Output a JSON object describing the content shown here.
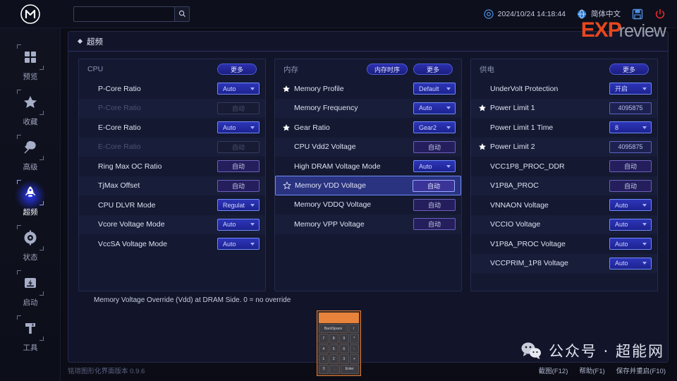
{
  "topbar": {
    "logo_name": "maxsun-logo",
    "search_value": "",
    "search_placeholder": "",
    "search_icon": "search-icon",
    "datetime": "2024/10/24 14:18:44",
    "datetime_icon": "clock-icon",
    "language": "简体中文",
    "language_icon": "globe-icon",
    "save_icon": "save-icon",
    "power_icon": "power-icon"
  },
  "watermark": {
    "exp": "EXP",
    "review": "review",
    "wechat_icon": "wechat-icon",
    "wechat_text": "公众号 · 超能网"
  },
  "sidebar": {
    "items": [
      {
        "label": "预览",
        "icon": "grid-icon",
        "active": false
      },
      {
        "label": "收藏",
        "icon": "star-icon",
        "active": false
      },
      {
        "label": "高级",
        "icon": "wrench-icon",
        "active": false
      },
      {
        "label": "超频",
        "icon": "rocket-icon",
        "active": true
      },
      {
        "label": "状态",
        "icon": "gauge-icon",
        "active": false
      },
      {
        "label": "启动",
        "icon": "boot-icon",
        "active": false
      },
      {
        "label": "工具",
        "icon": "tools-icon",
        "active": false
      }
    ]
  },
  "tab": {
    "label": "超频",
    "bullet_icon": "diamond-bullet-icon"
  },
  "columns": [
    {
      "title": "CPU",
      "buttons": [
        {
          "label": "更多",
          "name": "cpu-more-button"
        }
      ],
      "rows": [
        {
          "label": "P-Core Ratio",
          "value": "Auto",
          "type": "select",
          "star": false,
          "disabled": false,
          "selected": false
        },
        {
          "label": "P-Core Ratio",
          "value": "自动",
          "type": "text",
          "star": false,
          "disabled": true,
          "selected": false
        },
        {
          "label": "E-Core Ratio",
          "value": "Auto",
          "type": "select",
          "star": false,
          "disabled": false,
          "selected": false
        },
        {
          "label": "E-Core Ratio",
          "value": "自动",
          "type": "text",
          "star": false,
          "disabled": true,
          "selected": false
        },
        {
          "label": "Ring Max OC Ratio",
          "value": "自动",
          "type": "text",
          "star": false,
          "disabled": false,
          "selected": false
        },
        {
          "label": "TjMax Offset",
          "value": "自动",
          "type": "text",
          "star": false,
          "disabled": false,
          "selected": false
        },
        {
          "label": "CPU DLVR Mode",
          "value": "Regulat",
          "type": "select",
          "star": false,
          "disabled": false,
          "selected": false
        },
        {
          "label": "Vcore Voltage Mode",
          "value": "Auto",
          "type": "select",
          "star": false,
          "disabled": false,
          "selected": false
        },
        {
          "label": "VccSA Voltage Mode",
          "value": "Auto",
          "type": "select",
          "star": false,
          "disabled": false,
          "selected": false
        }
      ]
    },
    {
      "title": "内存",
      "buttons": [
        {
          "label": "内存时序",
          "name": "memory-timing-button"
        },
        {
          "label": "更多",
          "name": "memory-more-button"
        }
      ],
      "rows": [
        {
          "label": "Memory Profile",
          "value": "Default",
          "type": "select",
          "star": true,
          "disabled": false,
          "selected": false
        },
        {
          "label": "Memory Frequency",
          "value": "Auto",
          "type": "select",
          "star": false,
          "disabled": false,
          "selected": false
        },
        {
          "label": "Gear Ratio",
          "value": "Gear2",
          "type": "select",
          "star": true,
          "disabled": false,
          "selected": false
        },
        {
          "label": "CPU Vdd2 Voltage",
          "value": "自动",
          "type": "text",
          "star": false,
          "disabled": false,
          "selected": false
        },
        {
          "label": "High DRAM Voltage Mode",
          "value": "Auto",
          "type": "select",
          "star": false,
          "disabled": false,
          "selected": false
        },
        {
          "label": "Memory VDD Voltage",
          "value": "自动",
          "type": "text",
          "star": "hollow",
          "disabled": false,
          "selected": true
        },
        {
          "label": "Memory VDDQ Voltage",
          "value": "自动",
          "type": "text",
          "star": false,
          "disabled": false,
          "selected": false
        },
        {
          "label": "Memory VPP Voltage",
          "value": "自动",
          "type": "text",
          "star": false,
          "disabled": false,
          "selected": false
        }
      ]
    },
    {
      "title": "供电",
      "buttons": [
        {
          "label": "更多",
          "name": "power-more-button"
        }
      ],
      "rows": [
        {
          "label": "UnderVolt Protection",
          "value": "开启",
          "type": "select",
          "star": false,
          "disabled": false,
          "selected": false
        },
        {
          "label": "Power Limit 1",
          "value": "4095875",
          "type": "num",
          "star": true,
          "disabled": false,
          "selected": false
        },
        {
          "label": "Power Limit 1 Time",
          "value": "8",
          "type": "select",
          "star": false,
          "disabled": false,
          "selected": false
        },
        {
          "label": "Power Limit 2",
          "value": "4095875",
          "type": "num",
          "star": true,
          "disabled": false,
          "selected": false
        },
        {
          "label": "VCC1P8_PROC_DDR",
          "value": "自动",
          "type": "text",
          "star": false,
          "disabled": false,
          "selected": false
        },
        {
          "label": "V1P8A_PROC",
          "value": "自动",
          "type": "text",
          "star": false,
          "disabled": false,
          "selected": false
        },
        {
          "label": "VNNAON Voltage",
          "value": "Auto",
          "type": "select",
          "star": false,
          "disabled": false,
          "selected": false
        },
        {
          "label": "VCCIO Voltage",
          "value": "Auto",
          "type": "select",
          "star": false,
          "disabled": false,
          "selected": false
        },
        {
          "label": "V1P8A_PROC Voltage",
          "value": "Auto",
          "type": "select",
          "star": false,
          "disabled": false,
          "selected": false
        },
        {
          "label": "VCCPRIM_1P8 Voltage",
          "value": "Auto",
          "type": "select",
          "star": false,
          "disabled": false,
          "selected": false
        }
      ]
    }
  ],
  "help": {
    "text": "Memory Voltage Override (Vdd) at DRAM Side. 0 = no override"
  },
  "keypad": {
    "display": "",
    "rows": [
      [
        {
          "label": "BackSpace",
          "wide": 3
        },
        {
          "label": "/",
          "wide": 1
        }
      ],
      [
        {
          "label": "7"
        },
        {
          "label": "8"
        },
        {
          "label": "9"
        },
        {
          "label": "*"
        }
      ],
      [
        {
          "label": "4"
        },
        {
          "label": "5"
        },
        {
          "label": "6"
        },
        {
          "label": "-"
        }
      ],
      [
        {
          "label": "1"
        },
        {
          "label": "2"
        },
        {
          "label": "3"
        },
        {
          "label": "+"
        }
      ],
      [
        {
          "label": "0"
        },
        {
          "label": "."
        },
        {
          "label": "Enter",
          "wide": 2
        }
      ]
    ]
  },
  "footer": {
    "version": "铭瑄图形化界面版本 0.9.6",
    "keys": [
      {
        "label": "截图(F12)",
        "name": "screenshot-key"
      },
      {
        "label": "帮助(F1)",
        "name": "help-key"
      },
      {
        "label": "保存并重启(F10)",
        "name": "save-reboot-key"
      }
    ]
  },
  "colors": {
    "accent_blue": "#6f8cf5",
    "panel_bg": "#12152a",
    "select_bg": "#2d35b8",
    "selected_row": "#2a3380",
    "exp_orange": "#e8471d",
    "keypad_orange": "#e8833c"
  }
}
